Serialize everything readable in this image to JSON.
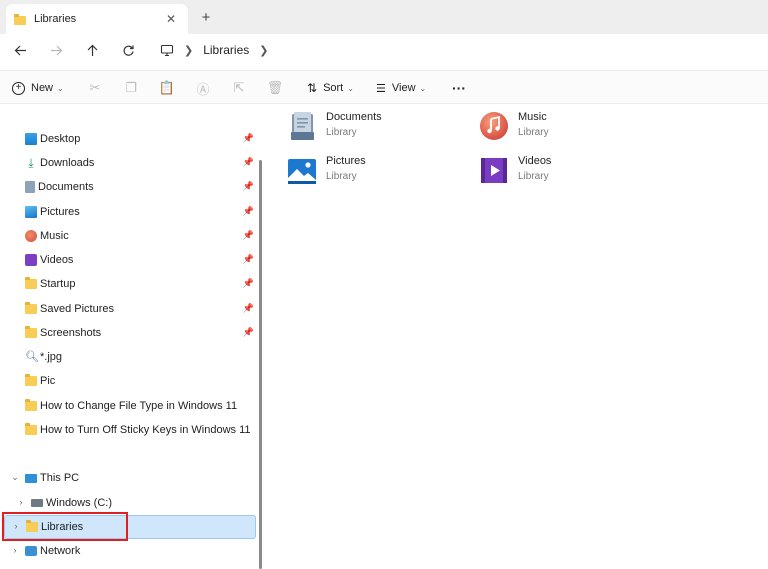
{
  "tab": {
    "title": "Libraries"
  },
  "address": {
    "crumbs": [
      "Libraries"
    ]
  },
  "commands": {
    "new": "New",
    "sort": "Sort",
    "view": "View",
    "more": "···"
  },
  "nav": {
    "quick_access": [
      {
        "label": "Desktop",
        "icon": "desktop-icon",
        "pinned": true
      },
      {
        "label": "Downloads",
        "icon": "download-icon",
        "pinned": true
      },
      {
        "label": "Documents",
        "icon": "documents-icon",
        "pinned": true
      },
      {
        "label": "Pictures",
        "icon": "pictures-icon",
        "pinned": true
      },
      {
        "label": "Music",
        "icon": "music-icon",
        "pinned": true
      },
      {
        "label": "Videos",
        "icon": "videos-icon",
        "pinned": true
      },
      {
        "label": "Startup",
        "icon": "folder-icon",
        "pinned": true
      },
      {
        "label": "Saved Pictures",
        "icon": "folder-icon",
        "pinned": true
      },
      {
        "label": "Screenshots",
        "icon": "folder-icon",
        "pinned": true
      },
      {
        "label": "*.jpg",
        "icon": "search-icon",
        "pinned": false
      },
      {
        "label": "Pic",
        "icon": "folder-icon",
        "pinned": false
      },
      {
        "label": "How to Change File Type in Windows 11",
        "icon": "folder-icon",
        "pinned": false
      },
      {
        "label": "How to Turn Off Sticky Keys in Windows 11",
        "icon": "folder-icon",
        "pinned": false
      }
    ],
    "tree": [
      {
        "label": "This PC",
        "icon": "pc-icon"
      },
      {
        "label": "Windows (C:)",
        "icon": "drive-icon"
      },
      {
        "label": "Libraries",
        "icon": "folder-icon"
      },
      {
        "label": "Network",
        "icon": "network-icon"
      }
    ]
  },
  "libraries": [
    {
      "name": "Documents",
      "sub": "Library",
      "icon": "documents-library-icon"
    },
    {
      "name": "Music",
      "sub": "Library",
      "icon": "music-library-icon"
    },
    {
      "name": "Pictures",
      "sub": "Library",
      "icon": "pictures-library-icon"
    },
    {
      "name": "Videos",
      "sub": "Library",
      "icon": "videos-library-icon"
    }
  ],
  "colors": {
    "folder": "#f7cd55",
    "selection": "#cfe6fb",
    "highlight": "#e02020"
  }
}
